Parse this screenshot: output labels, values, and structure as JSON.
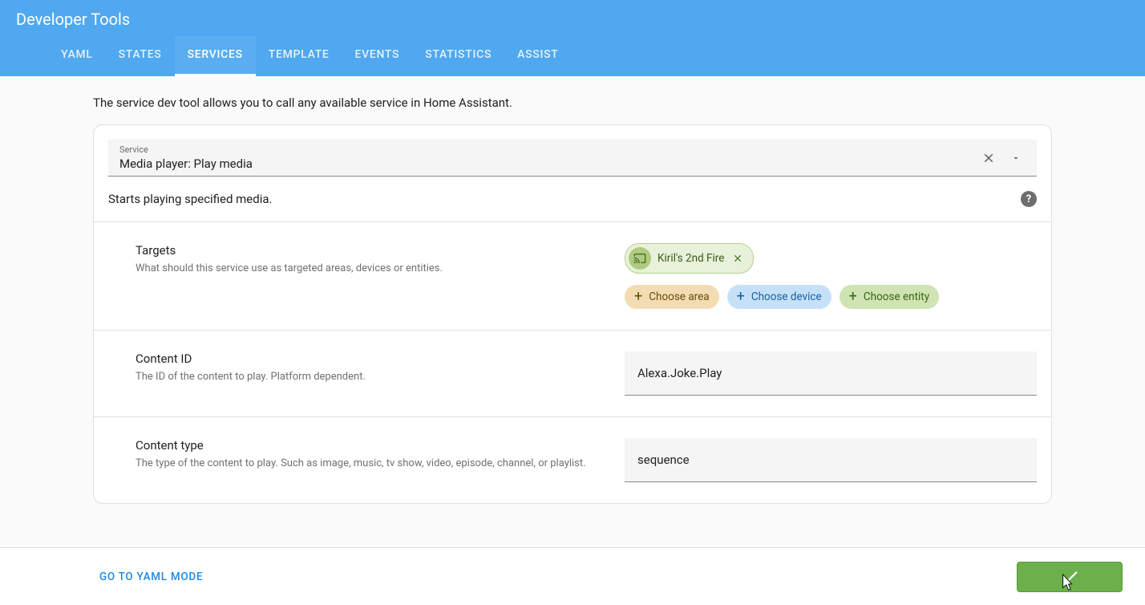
{
  "header": {
    "title": "Developer Tools",
    "tabs": [
      "YAML",
      "STATES",
      "SERVICES",
      "TEMPLATE",
      "EVENTS",
      "STATISTICS",
      "ASSIST"
    ],
    "active_tab_index": 2
  },
  "intro": "The service dev tool allows you to call any available service in Home Assistant.",
  "service_select": {
    "label": "Service",
    "value": "Media player: Play media"
  },
  "description": "Starts playing specified media.",
  "fields": {
    "targets": {
      "title": "Targets",
      "help": "What should this service use as targeted areas, devices or entities.",
      "selected_entity": "Kiril's 2nd Fire",
      "choose_area": "Choose area",
      "choose_device": "Choose device",
      "choose_entity": "Choose entity"
    },
    "content_id": {
      "title": "Content ID",
      "help": "The ID of the content to play. Platform dependent.",
      "value": "Alexa.Joke.Play"
    },
    "content_type": {
      "title": "Content type",
      "help": "The type of the content to play. Such as image, music, tv show, video, episode, channel, or playlist.",
      "value": "sequence"
    }
  },
  "bottom": {
    "yaml_mode": "GO TO YAML MODE"
  },
  "colors": {
    "header_bg": "#4fa8f0",
    "call_btn": "#6bb04a"
  }
}
